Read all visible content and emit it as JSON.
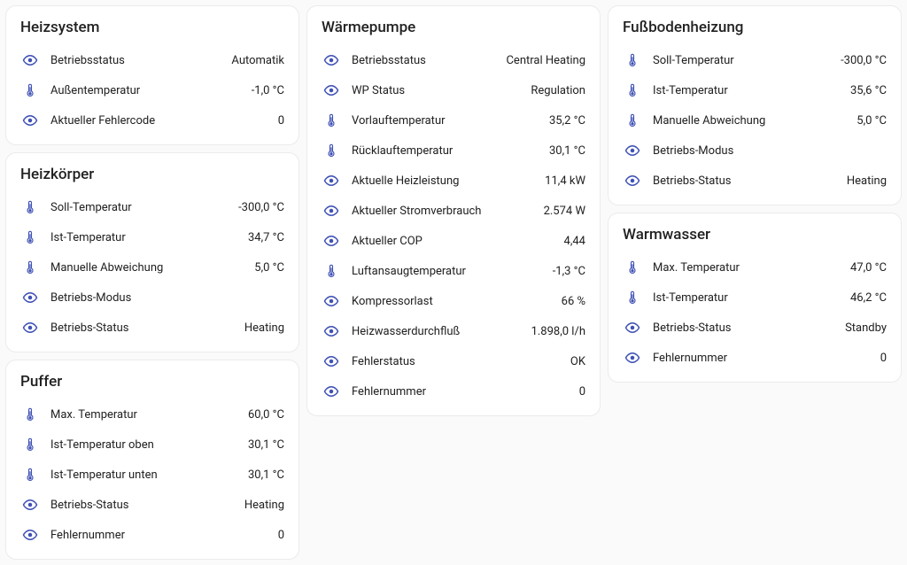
{
  "icons": {
    "eye": "eye",
    "thermo": "thermo"
  },
  "col1": [
    {
      "title": "Heizsystem",
      "rows": [
        {
          "icon": "eye",
          "label": "Betriebsstatus",
          "value": "Automatik"
        },
        {
          "icon": "thermo",
          "label": "Außentemperatur",
          "value": "-1,0 °C"
        },
        {
          "icon": "eye",
          "label": "Aktueller Fehlercode",
          "value": "0"
        }
      ]
    },
    {
      "title": "Heizkörper",
      "rows": [
        {
          "icon": "thermo",
          "label": "Soll-Temperatur",
          "value": "-300,0 °C"
        },
        {
          "icon": "thermo",
          "label": "Ist-Temperatur",
          "value": "34,7 °C"
        },
        {
          "icon": "thermo",
          "label": "Manuelle Abweichung",
          "value": "5,0 °C"
        },
        {
          "icon": "eye",
          "label": "Betriebs-Modus",
          "value": ""
        },
        {
          "icon": "eye",
          "label": "Betriebs-Status",
          "value": "Heating"
        }
      ]
    },
    {
      "title": "Puffer",
      "rows": [
        {
          "icon": "thermo",
          "label": "Max. Temperatur",
          "value": "60,0 °C"
        },
        {
          "icon": "thermo",
          "label": "Ist-Temperatur oben",
          "value": "30,1 °C"
        },
        {
          "icon": "thermo",
          "label": "Ist-Temperatur unten",
          "value": "30,1 °C"
        },
        {
          "icon": "eye",
          "label": "Betriebs-Status",
          "value": "Heating"
        },
        {
          "icon": "eye",
          "label": "Fehlernummer",
          "value": "0"
        }
      ]
    }
  ],
  "col2": [
    {
      "title": "Wärmepumpe",
      "rows": [
        {
          "icon": "eye",
          "label": "Betriebsstatus",
          "value": "Central Heating"
        },
        {
          "icon": "eye",
          "label": "WP Status",
          "value": "Regulation"
        },
        {
          "icon": "thermo",
          "label": "Vorlauftemperatur",
          "value": "35,2 °C"
        },
        {
          "icon": "thermo",
          "label": "Rücklauftemperatur",
          "value": "30,1 °C"
        },
        {
          "icon": "eye",
          "label": "Aktuelle Heizleistung",
          "value": "11,4 kW"
        },
        {
          "icon": "eye",
          "label": "Aktueller Stromverbrauch",
          "value": "2.574 W"
        },
        {
          "icon": "eye",
          "label": "Aktueller COP",
          "value": "4,44"
        },
        {
          "icon": "thermo",
          "label": "Luftansaugtemperatur",
          "value": "-1,3 °C"
        },
        {
          "icon": "eye",
          "label": "Kompressorlast",
          "value": "66 %"
        },
        {
          "icon": "eye",
          "label": "Heizwasserdurchfluß",
          "value": "1.898,0 l/h"
        },
        {
          "icon": "eye",
          "label": "Fehlerstatus",
          "value": "OK"
        },
        {
          "icon": "eye",
          "label": "Fehlernummer",
          "value": "0"
        }
      ]
    }
  ],
  "col3": [
    {
      "title": "Fußbodenheizung",
      "rows": [
        {
          "icon": "thermo",
          "label": "Soll-Temperatur",
          "value": "-300,0 °C"
        },
        {
          "icon": "thermo",
          "label": "Ist-Temperatur",
          "value": "35,6 °C"
        },
        {
          "icon": "thermo",
          "label": "Manuelle Abweichung",
          "value": "5,0 °C"
        },
        {
          "icon": "eye",
          "label": "Betriebs-Modus",
          "value": ""
        },
        {
          "icon": "eye",
          "label": "Betriebs-Status",
          "value": "Heating"
        }
      ]
    },
    {
      "title": "Warmwasser",
      "rows": [
        {
          "icon": "thermo",
          "label": "Max. Temperatur",
          "value": "47,0 °C"
        },
        {
          "icon": "thermo",
          "label": "Ist-Temperatur",
          "value": "46,2 °C"
        },
        {
          "icon": "eye",
          "label": "Betriebs-Status",
          "value": "Standby"
        },
        {
          "icon": "eye",
          "label": "Fehlernummer",
          "value": "0"
        }
      ]
    }
  ]
}
